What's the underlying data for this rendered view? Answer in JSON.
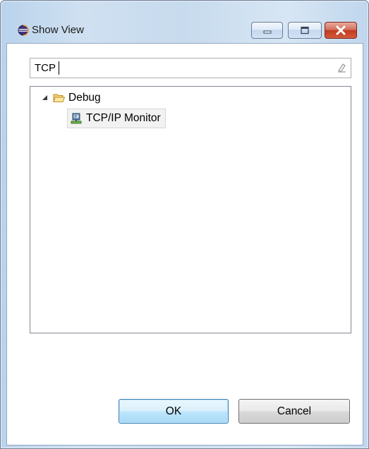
{
  "window": {
    "title": "Show View",
    "icon": "eclipse-icon",
    "controls": [
      "minimize-icon",
      "maximize-icon",
      "close-icon"
    ]
  },
  "filter": {
    "value": "TCP",
    "clear_icon": "clear-eraser-icon"
  },
  "tree": {
    "category": {
      "label": "Debug",
      "expanded": true,
      "icon": "open-folder-icon"
    },
    "items": [
      {
        "label": "TCP/IP Monitor",
        "icon": "tcp-ip-monitor-icon",
        "selected": true
      }
    ]
  },
  "buttons": {
    "ok_label": "OK",
    "cancel_label": "Cancel"
  },
  "colors": {
    "title_bar": "#cfe0f1",
    "close_button": "#c23b1f",
    "default_button_border": "#3c7fb1",
    "folder": "#e8b94a"
  }
}
